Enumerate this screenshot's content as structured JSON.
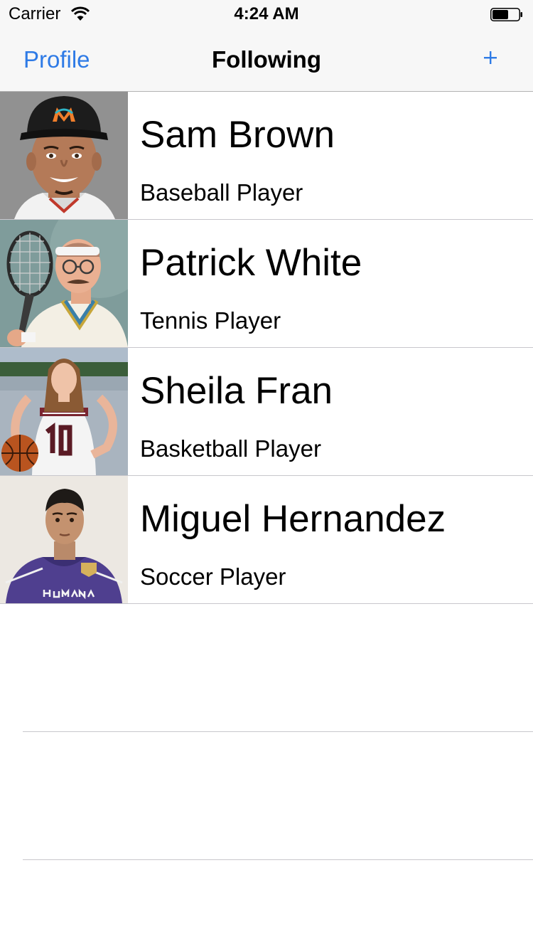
{
  "status_bar": {
    "carrier": "Carrier",
    "time": "4:24 AM"
  },
  "nav": {
    "back_label": "Profile",
    "title": "Following",
    "add_icon": "plus-icon"
  },
  "colors": {
    "tint": "#2f7be6",
    "bar_background": "#f7f7f7",
    "separator": "#c8c7cc"
  },
  "following": [
    {
      "name": "Sam Brown",
      "role": "Baseball Player"
    },
    {
      "name": "Patrick White",
      "role": "Tennis Player"
    },
    {
      "name": "Sheila Fran",
      "role": "Basketball Player"
    },
    {
      "name": "Miguel Hernandez",
      "role": "Soccer Player"
    }
  ]
}
